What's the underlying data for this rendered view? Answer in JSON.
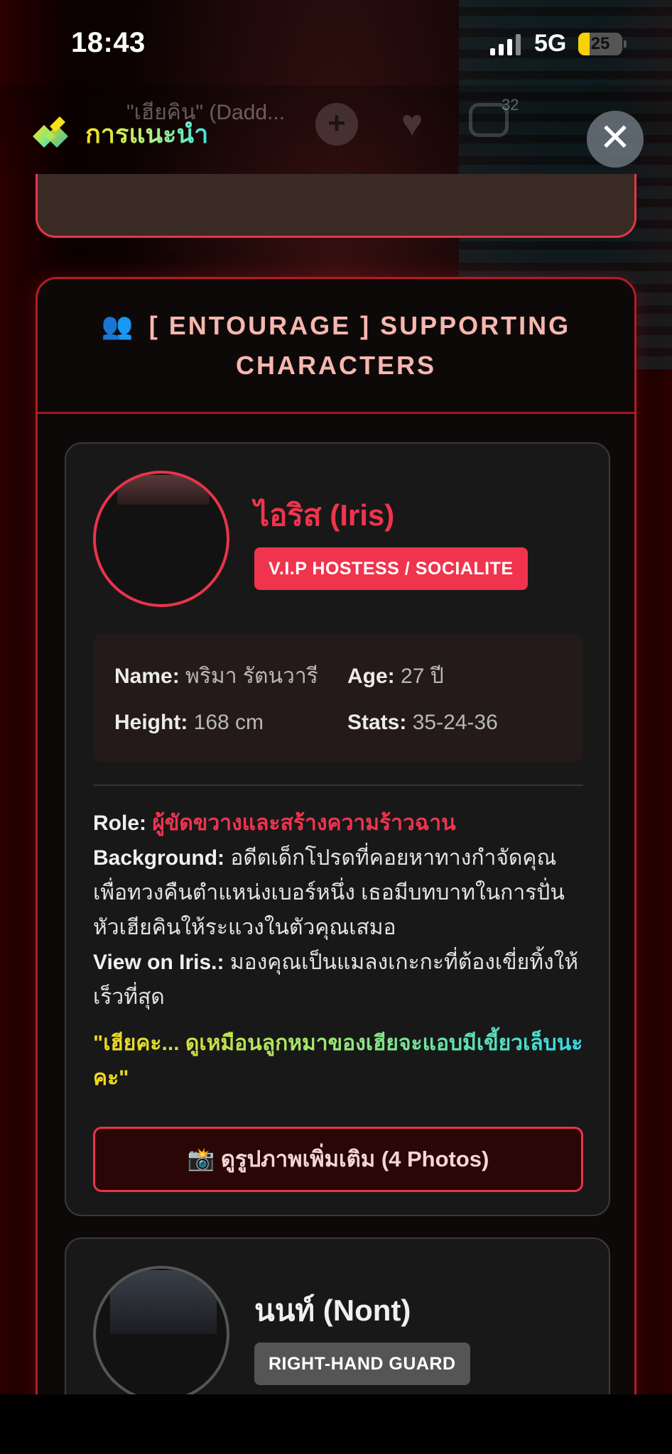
{
  "status_bar": {
    "time": "18:43",
    "network": "5G",
    "battery": "25",
    "battery_level_percent": 25
  },
  "top_nav": {
    "faded_title": "\"เฮียคิน\" (Dadd...",
    "comment_count": "32",
    "recommend_label": "การแนะนำ",
    "icons": [
      "plus-icon",
      "heart-icon",
      "comment-icon",
      "close-icon"
    ]
  },
  "section": {
    "icon": "👥",
    "title_line1": "[ ENTOURAGE ] SUPPORTING",
    "title_line2": "CHARACTERS"
  },
  "characters": [
    {
      "name": "ไอริส (Iris)",
      "badge": "V.I.P HOSTESS / SOCIALITE",
      "stats": {
        "name_label": "Name:",
        "name_value": "พริมา รัตนวารี",
        "age_label": "Age:",
        "age_value": "27 ปี",
        "height_label": "Height:",
        "height_value": "168 cm",
        "stats_label": "Stats:",
        "stats_value": "35-24-36"
      },
      "role_label": "Role:",
      "role_value": "ผู้ขัดขวางและสร้างความร้าวฉาน",
      "background_label": "Background:",
      "background_value": "อดีตเด็กโปรดที่คอยหาทางกำจัดคุณเพื่อทวงคืนตำแหน่งเบอร์หนึ่ง เธอมีบทบาทในการปั่นหัวเฮียคินให้ระแวงในตัวคุณเสมอ",
      "view_label": "View on Iris.:",
      "view_value": "มองคุณเป็นแมลงเกะกะที่ต้องเขี่ยทิ้งให้เร็วที่สุด",
      "quote": "\"เฮียคะ... ดูเหมือนลูกหมาของเฮียจะแอบมีเขี้ยวเล็บนะคะ\"",
      "photos_button": "📸 ดูรูปภาพเพิ่มเติม (4 Photos)"
    },
    {
      "name": "นนท์ (Nont)",
      "badge": "RIGHT-HAND GUARD"
    }
  ],
  "colors": {
    "accent_red": "#f0344e",
    "section_border": "#b51a26",
    "title_pink": "#f7b7ae"
  }
}
